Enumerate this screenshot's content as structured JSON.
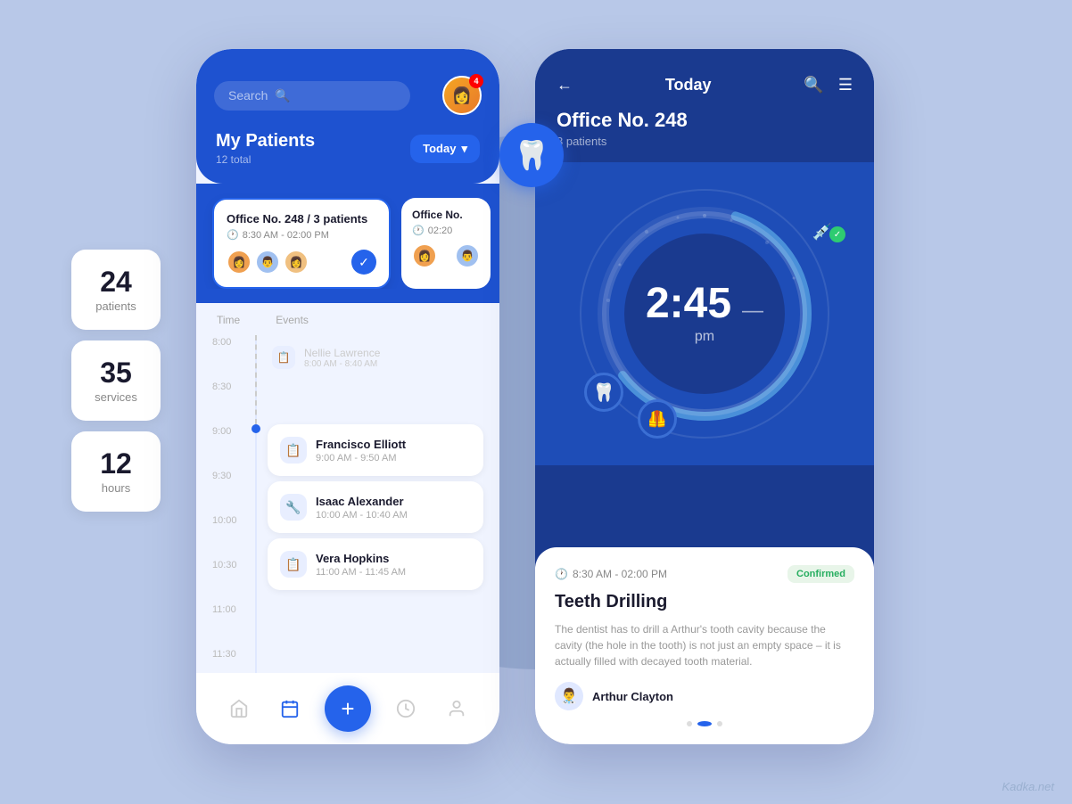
{
  "background": {
    "color": "#b8c8e8"
  },
  "stats": [
    {
      "number": "24",
      "label": "patients"
    },
    {
      "number": "35",
      "label": "services"
    },
    {
      "number": "12",
      "label": "hours"
    }
  ],
  "left_phone": {
    "search_placeholder": "Search",
    "notification_count": "4",
    "patients_title": "My Patients",
    "patients_subtitle": "12 total",
    "today_btn": "Today",
    "office_cards": [
      {
        "title": "Office No. 248",
        "patients_count": "3 patients",
        "time": "8:30 AM - 02:00 PM",
        "avatars": [
          "👩",
          "👨",
          "👩"
        ],
        "active": true
      },
      {
        "title": "Office No.",
        "time": "02:20",
        "avatars": [
          "👩",
          "👨"
        ],
        "active": false
      }
    ],
    "timeline": {
      "cols": [
        "Time",
        "Events"
      ],
      "times": [
        "8:00",
        "8:30",
        "9:00",
        "9:30",
        "10:00",
        "10:30",
        "11:00",
        "11:30"
      ],
      "ghost_event": {
        "name": "Nellie Lawrence",
        "time": "8:00 AM - 8:40 AM"
      },
      "events": [
        {
          "name": "Francisco Elliott",
          "time": "9:00 AM - 9:50 AM",
          "icon": "📋"
        },
        {
          "name": "Isaac Alexander",
          "time": "10:00 AM - 10:40 AM",
          "icon": "🔧"
        },
        {
          "name": "Vera Hopkins",
          "time": "11:00 AM - 11:45 AM",
          "icon": "📋"
        }
      ]
    },
    "nav_items": [
      "home",
      "calendar",
      "add",
      "clock",
      "person"
    ]
  },
  "right_phone": {
    "header_title": "Today",
    "office_name": "Office No. 248",
    "office_sub": "3 patients",
    "clock_time": "2:45",
    "clock_ampm": "pm",
    "appointment": {
      "time": "8:30 AM - 02:00 PM",
      "status": "Confirmed",
      "title": "Teeth Drilling",
      "description": "The dentist has to drill a Arthur's tooth cavity because the cavity (the hole in the tooth) is not just an empty space – it is actually filled with decayed tooth material.",
      "doctor": "Arthur Clayton"
    }
  },
  "watermark": "Kadka.net"
}
